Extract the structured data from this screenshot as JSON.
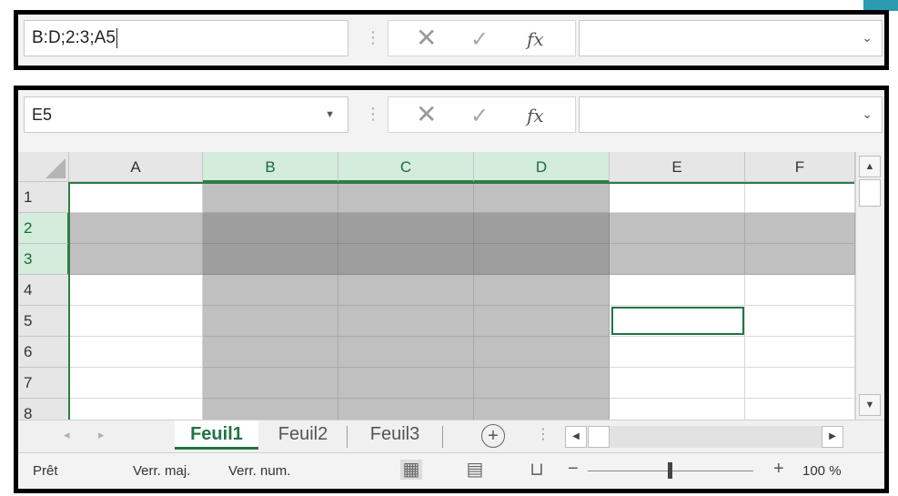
{
  "formula_bar_top": {
    "name_box_value": "B:D;2:3;A5",
    "cancel_icon": "x-icon",
    "enter_icon": "check-icon",
    "function_label": "fx",
    "formula_value": ""
  },
  "formula_bar_main": {
    "name_box_value": "E5",
    "function_label": "fx",
    "formula_value": ""
  },
  "columns": [
    "A",
    "B",
    "C",
    "D",
    "E",
    "F"
  ],
  "selected_columns": [
    "B",
    "C",
    "D"
  ],
  "rows": [
    "1",
    "2",
    "3",
    "4",
    "5",
    "6",
    "7",
    "8"
  ],
  "selected_rows": [
    "2",
    "3"
  ],
  "active_cell": "E5",
  "sheets": [
    "Feuil1",
    "Feuil2",
    "Feuil3"
  ],
  "active_sheet": "Feuil1",
  "status": {
    "ready": "Prêt",
    "caps_lock": "Verr. maj.",
    "num_lock": "Verr. num.",
    "zoom_level": "100 %"
  },
  "colors": {
    "accent": "#217346",
    "selection": "#c0c0c0",
    "selection_overlap": "#9e9e9e",
    "header_selected": "#d3ecdc"
  }
}
